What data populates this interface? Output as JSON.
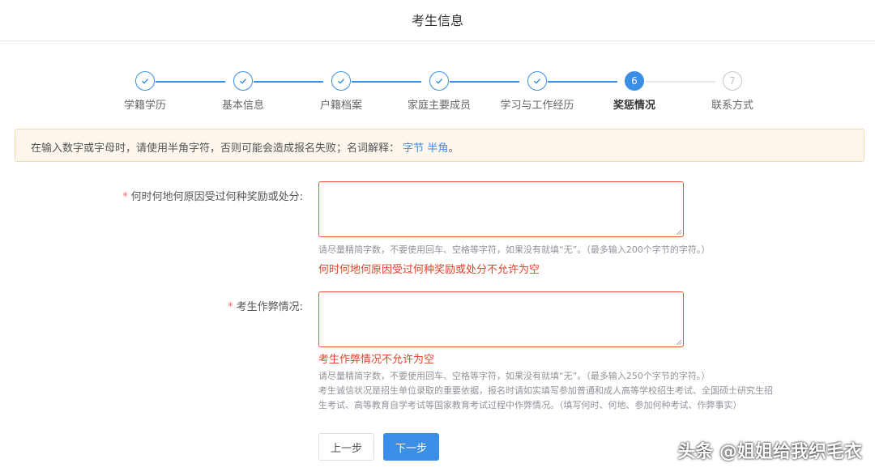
{
  "page": {
    "title": "考生信息"
  },
  "steps": [
    {
      "label": "学籍学历",
      "status": "done"
    },
    {
      "label": "基本信息",
      "status": "done"
    },
    {
      "label": "户籍档案",
      "status": "done"
    },
    {
      "label": "家庭主要成员",
      "status": "done"
    },
    {
      "label": "学习与工作经历",
      "status": "done"
    },
    {
      "label": "奖惩情况",
      "status": "active",
      "number": "6"
    },
    {
      "label": "联系方式",
      "status": "todo",
      "number": "7"
    }
  ],
  "notice": {
    "text": "在输入数字或字母时，请使用半角字符，否则可能会造成报名失败；名词解释：",
    "link1": "字节",
    "link2": "半角",
    "end": "。"
  },
  "form": {
    "reward": {
      "required_mark": "*",
      "label": "何时何地何原因受过何种奖励或处分:",
      "value": "",
      "hint": "请尽量精简字数，不要使用回车、空格等字符，如果没有就填“无”。（最多输入200个字节的字符。）",
      "error": "何时何地何原因受过何种奖励或处分不允许为空"
    },
    "cheating": {
      "required_mark": "*",
      "label": "考生作弊情况:",
      "value": "",
      "error": "考生作弊情况不允许为空",
      "hint1": "请尽量精简字数，不要使用回车、空格等字符，如果没有就填“无”。（最多输入250个字节的字符。）",
      "hint2": "考生诚信状况是招生单位录取的重要依据，报名时请如实填写参加普通和成人高等学校招生考试、全国硕士研究生招",
      "hint3": "生考试、高等教育自学考试等国家教育考试过程中作弊情况。（填写何时、何地、参加何种考试、作弊事实）"
    }
  },
  "buttons": {
    "prev": "上一步",
    "next": "下一步"
  },
  "watermark": "头条 @姐姐给我织毛衣",
  "colors": {
    "primary": "#3a8ee6",
    "error": "#e0442b",
    "notice_bg": "#fdf6ec"
  }
}
